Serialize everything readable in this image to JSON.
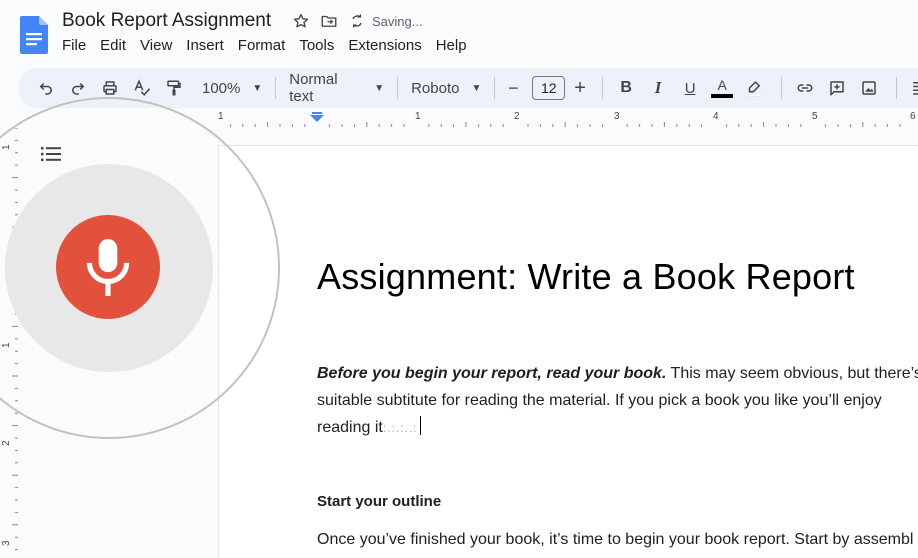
{
  "header": {
    "title": "Book Report Assignment",
    "saving_status": "Saving...",
    "menu": [
      "File",
      "Edit",
      "View",
      "Insert",
      "Format",
      "Tools",
      "Extensions",
      "Help"
    ]
  },
  "toolbar": {
    "zoom": "100%",
    "style": "Normal text",
    "font": "Roboto",
    "font_size": "12",
    "minus": "−",
    "plus": "+",
    "bold": "B",
    "italic": "I",
    "underline": "U",
    "text_color_glyph": "A"
  },
  "ruler": {
    "labels": [
      "1",
      "1",
      "2",
      "3",
      "4",
      "5",
      "6"
    ]
  },
  "vruler": {
    "labels": [
      "1",
      "1",
      "2",
      "3"
    ]
  },
  "document": {
    "heading": "Assignment: Write a Book Report",
    "para1_lead": "Before you begin your report, read your book.",
    "para1_line1_rest": " This may seem obvious, but there’s n",
    "para1_line2": "suitable subtitute for reading the material. If you pick a book you like you’ll enjoy",
    "para1_line3": "reading it",
    "para1_dots": ":.:.:..:",
    "subheading": "Start your outline",
    "para2": "Once you’ve finished your book, it’s time to begin your book report. Start by assembl"
  },
  "colors": {
    "mic": "#e1513b",
    "toolbar_bg": "#edf2fa",
    "docs_blue": "#4285f4"
  },
  "icons": [
    "docs-logo-icon",
    "star-icon",
    "move-folder-icon",
    "sync-icon",
    "undo-icon",
    "redo-icon",
    "print-icon",
    "spellcheck-icon",
    "paint-format-icon",
    "link-icon",
    "add-comment-icon",
    "insert-image-icon",
    "align-left-icon",
    "outline-icon",
    "microphone-icon"
  ]
}
